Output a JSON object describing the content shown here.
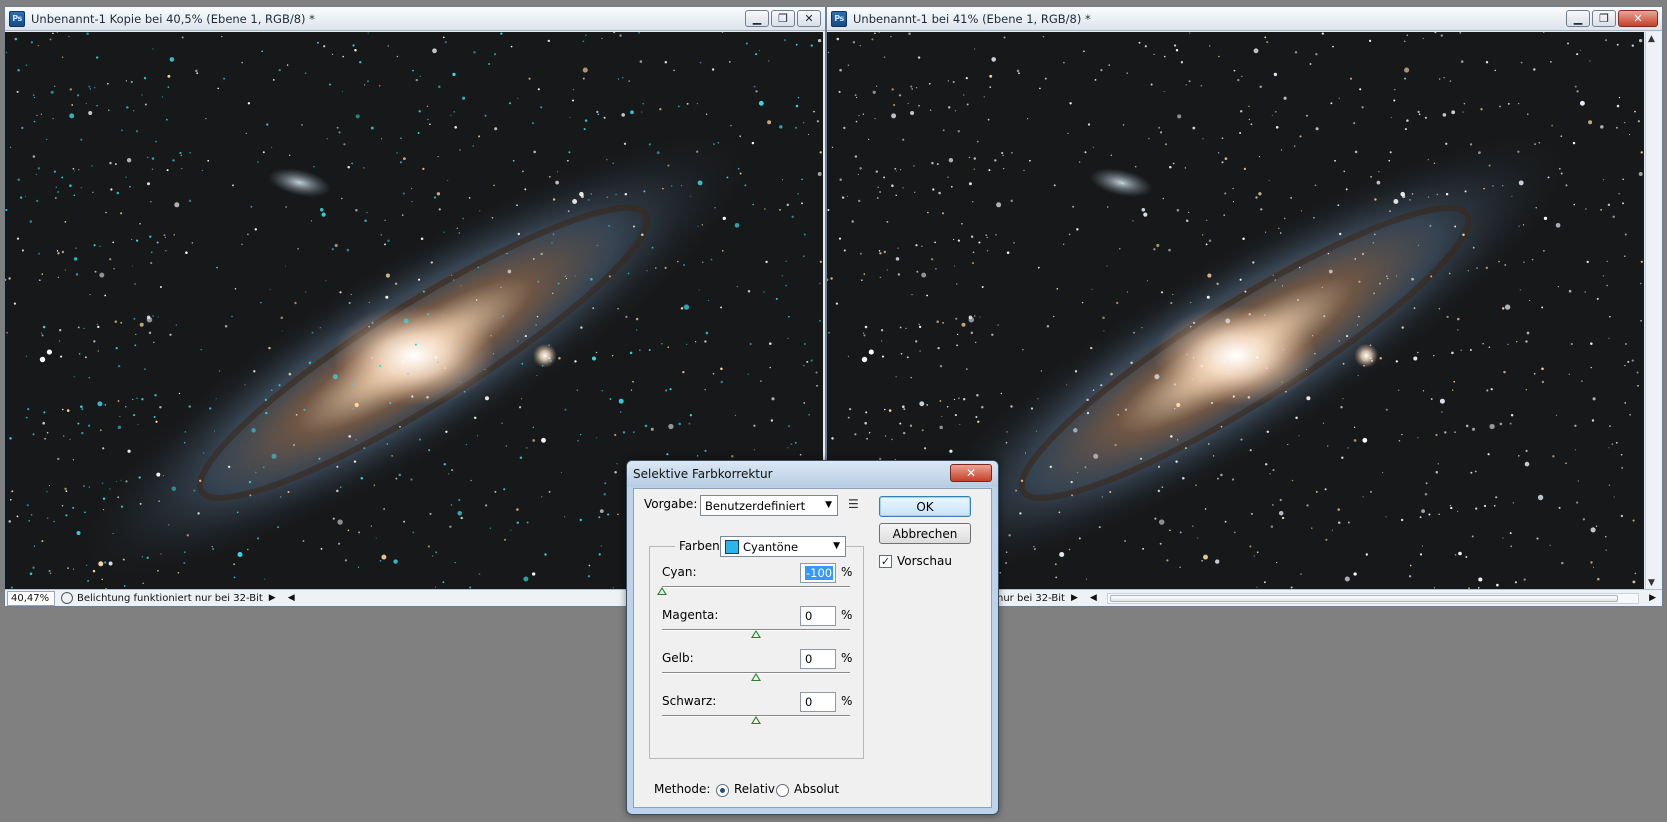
{
  "windows": [
    {
      "title": "Unbenannt-1 Kopie bei 40,5% (Ebene 1, RGB/8) *",
      "zoom": "40,47%",
      "status_text": "Belichtung funktioniert nur bei 32-Bit"
    },
    {
      "title": "Unbenannt-1 bei 41% (Ebene 1, RGB/8) *",
      "status_text": "nur bei 32-Bit"
    }
  ],
  "app_icon_text": "Ps",
  "dialog": {
    "title": "Selektive Farbkorrektur",
    "preset_label": "Vorgabe:",
    "preset_value": "Benutzerdefiniert",
    "colors_label": "Farben:",
    "colors_value": "Cyantöne",
    "sliders": [
      {
        "label": "Cyan:",
        "value": "-100",
        "percent": "%",
        "level": -100
      },
      {
        "label": "Magenta:",
        "value": "0",
        "percent": "%",
        "level": 0
      },
      {
        "label": "Gelb:",
        "value": "0",
        "percent": "%",
        "level": 0
      },
      {
        "label": "Schwarz:",
        "value": "0",
        "percent": "%",
        "level": 0
      }
    ],
    "ok_label": "OK",
    "cancel_label": "Abbrechen",
    "preview_label": "Vorschau",
    "preview_checked": true,
    "method_label": "Methode:",
    "method_relative": "Relativ",
    "method_absolute": "Absolut",
    "method_selected": "Relativ",
    "close_symbol": "✕"
  },
  "colors": {
    "left_star_tint": "#39d8e6",
    "right_star_tint": "#e8eef8",
    "cyan_swatch": "#2ab6e8"
  }
}
